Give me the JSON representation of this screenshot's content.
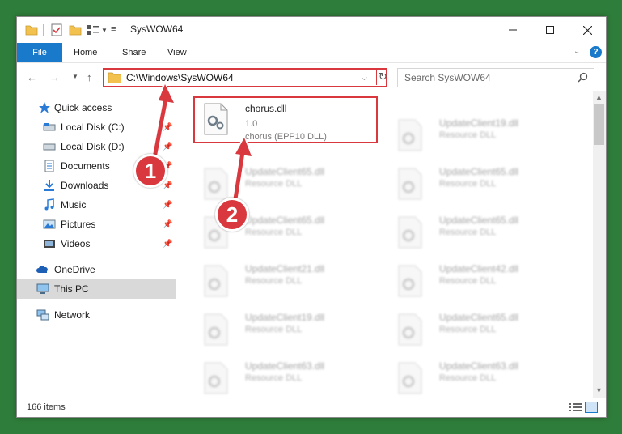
{
  "window": {
    "title": "SysWOW64"
  },
  "ribbon": {
    "file": "File",
    "home": "Home",
    "share": "Share",
    "view": "View"
  },
  "address": {
    "path": "C:\\Windows\\SysWOW64"
  },
  "search": {
    "placeholder": "Search SysWOW64"
  },
  "sidebar": {
    "items": [
      {
        "label": "Quick access",
        "icon": "star-icon"
      },
      {
        "label": "Local Disk (C:)",
        "icon": "drive-icon",
        "pinned": true
      },
      {
        "label": "Local Disk (D:)",
        "icon": "drive-icon",
        "pinned": true
      },
      {
        "label": "Documents",
        "icon": "documents-icon",
        "pinned": true
      },
      {
        "label": "Downloads",
        "icon": "download-icon",
        "pinned": true
      },
      {
        "label": "Music",
        "icon": "music-icon",
        "pinned": true
      },
      {
        "label": "Pictures",
        "icon": "pictures-icon",
        "pinned": true
      },
      {
        "label": "Videos",
        "icon": "videos-icon",
        "pinned": true
      },
      {
        "label": "OneDrive",
        "icon": "onedrive-icon"
      },
      {
        "label": "This PC",
        "icon": "computer-icon",
        "selected": true
      },
      {
        "label": "Network",
        "icon": "network-icon"
      }
    ]
  },
  "files": {
    "highlighted": {
      "name": "chorus.dll",
      "version": "1.0",
      "description": "chorus (EPP10 DLL)"
    },
    "right_column": [
      {
        "name": "UpdateClient19.dll",
        "description": "Resource DLL"
      },
      {
        "name": "UpdateClient65.dll",
        "description": "Resource DLL"
      },
      {
        "name": "UpdateClient65.dll",
        "description": "Resource DLL"
      },
      {
        "name": "UpdateClient42.dll",
        "description": "Resource DLL"
      },
      {
        "name": "UpdateClient65.dll",
        "description": "Resource DLL"
      },
      {
        "name": "UpdateClient63.dll",
        "description": "Resource DLL"
      }
    ],
    "left_column": [
      {
        "name": "UpdateClient65.dll",
        "description": "Resource DLL"
      },
      {
        "name": "UpdateClient65.dll",
        "description": "Resource DLL"
      },
      {
        "name": "UpdateClient21.dll",
        "description": "Resource DLL"
      },
      {
        "name": "UpdateClient19.dll",
        "description": "Resource DLL"
      },
      {
        "name": "UpdateClient63.dll",
        "description": "Resource DLL"
      }
    ]
  },
  "status": {
    "count": "166 items"
  },
  "annotations": {
    "step1": "1",
    "step2": "2"
  },
  "colors": {
    "accent": "#1979ca",
    "highlight": "#d9383e",
    "desktop": "#2f7d3a"
  }
}
